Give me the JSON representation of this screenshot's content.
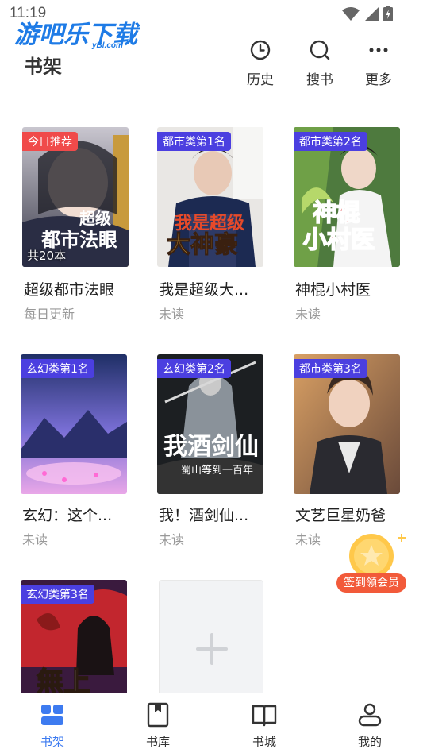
{
  "status_bar": {
    "time": "11:19"
  },
  "watermark": {
    "text": "游吧乐下载",
    "sub": "yBl.com"
  },
  "header": {
    "title": "书架",
    "actions": [
      {
        "label": "历史",
        "icon": "clock-icon"
      },
      {
        "label": "搜书",
        "icon": "search-icon"
      },
      {
        "label": "更多",
        "icon": "more-icon"
      }
    ]
  },
  "books": [
    {
      "title": "超级都市法眼",
      "status": "每日更新",
      "badge": "今日推荐",
      "count": "共20本",
      "cover_text": "超级都市法眼"
    },
    {
      "title": "我是超级大...",
      "status": "未读",
      "badge": "都市类第1名",
      "cover_text": "我是超级大神豪"
    },
    {
      "title": "神棍小村医",
      "status": "未读",
      "badge": "都市类第2名",
      "cover_text": "神棍小村医"
    },
    {
      "title": "玄幻：这个...",
      "status": "未读",
      "badge": "玄幻类第1名",
      "cover_text": ""
    },
    {
      "title": "我！酒剑仙...",
      "status": "未读",
      "badge": "玄幻类第2名",
      "cover_text": "我酒剑仙"
    },
    {
      "title": "文艺巨星奶爸",
      "status": "未读",
      "badge": "都市类第3名",
      "cover_text": ""
    },
    {
      "title": "",
      "status": "",
      "badge": "玄幻类第3名",
      "cover_text": "無上神帝"
    }
  ],
  "checkin": {
    "label": "签到领会员"
  },
  "tabbar": {
    "tabs": [
      {
        "label": "书架",
        "icon": "bookshelf-icon",
        "active": true
      },
      {
        "label": "书库",
        "icon": "library-icon",
        "active": false
      },
      {
        "label": "书城",
        "icon": "book-open-icon",
        "active": false
      },
      {
        "label": "我的",
        "icon": "profile-icon",
        "active": false
      }
    ]
  },
  "colors": {
    "accent": "#3d7bf0",
    "badge_blue": "#4b3fe0",
    "badge_red": "#f04a4a",
    "checkin": "#f25a3a"
  }
}
